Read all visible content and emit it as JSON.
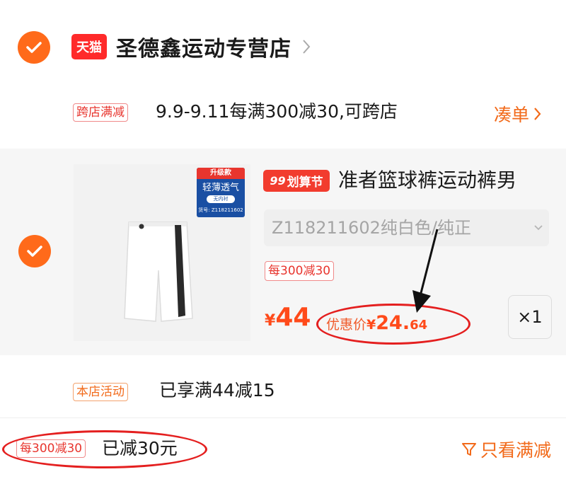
{
  "store": {
    "tmall_badge": "天猫",
    "name": "圣德鑫运动专营店"
  },
  "cross_store": {
    "tag": "跨店满减",
    "text": "9.9-9.11每满300减30,可跨店",
    "action": "凑单"
  },
  "product": {
    "image_badge_top": "升级款",
    "image_badge_main": "轻薄透气",
    "image_badge_sub": "无内衬",
    "image_badge_code": "货号: Z118211602",
    "promo_badge_num": "99",
    "promo_badge_text": "划算节",
    "title": "准者篮球裤运动裤男",
    "sku": "Z118211602纯白色/纯正",
    "discount_tag": "每300减30",
    "price_symbol": "¥",
    "price": "44",
    "deal_label": "优惠价",
    "deal_symbol": "¥",
    "deal_int": "24.",
    "deal_dec": "64",
    "quantity": "×1"
  },
  "store_activity": {
    "tag": "本店活动",
    "text": "已享满44减15"
  },
  "footer": {
    "tag": "每300减30",
    "text": "已减30元",
    "filter": "只看满减"
  },
  "colors": {
    "accent_orange": "#ff6a1a",
    "tmall_red": "#ff2a2a",
    "annotation_red": "#e41f1f"
  }
}
